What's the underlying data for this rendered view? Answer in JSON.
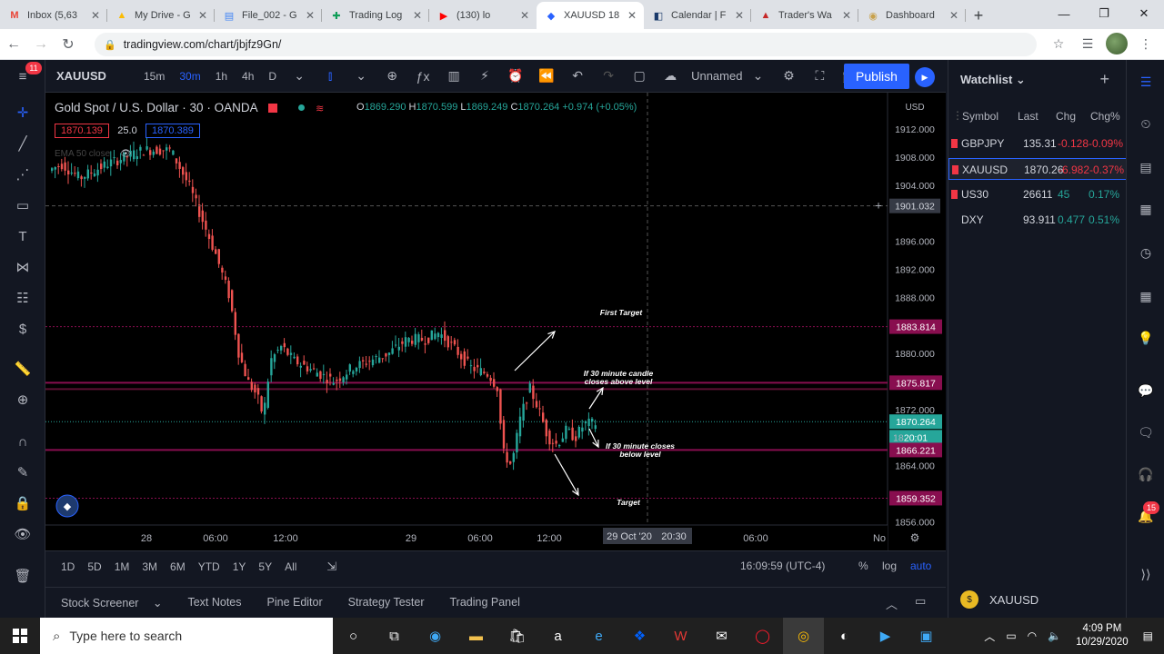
{
  "browser": {
    "tabs": [
      {
        "title": "Inbox (5,63",
        "icon": "gmail-icon",
        "color": "#ea4335",
        "glyph": "M"
      },
      {
        "title": "My Drive - G",
        "icon": "drive-icon",
        "color": "#fbbc04",
        "glyph": "▲"
      },
      {
        "title": "File_002 - G",
        "icon": "docs-icon",
        "color": "#4285f4",
        "glyph": "▤"
      },
      {
        "title": "Trading Log",
        "icon": "sheets-icon",
        "color": "#0f9d58",
        "glyph": "✚"
      },
      {
        "title": "(130) lo",
        "icon": "youtube-icon",
        "color": "#ff0000",
        "glyph": "▶"
      },
      {
        "title": "XAUUSD 18",
        "icon": "tradingview-icon",
        "color": "#2962ff",
        "glyph": "◆"
      },
      {
        "title": "Calendar | F",
        "icon": "calendar-icon",
        "color": "#1a3a6b",
        "glyph": "◧"
      },
      {
        "title": "Trader's Wa",
        "icon": "trader-icon",
        "color": "#c62828",
        "glyph": "▲"
      },
      {
        "title": "Dashboard",
        "icon": "dashboard-icon",
        "color": "#c8a14b",
        "glyph": "◉"
      }
    ],
    "active_tab": 5,
    "url": "tradingview.com/chart/jbjfz9Gn/"
  },
  "tv": {
    "symbol": "XAUUSD",
    "intervals": [
      "15m",
      "30m",
      "1h",
      "4h",
      "D"
    ],
    "active_interval": 1,
    "layout_name": "Unnamed",
    "publish_label": "Publish",
    "left_badge": "11",
    "legend_title": "Gold Spot / U.S. Dollar · 30 · OANDA",
    "ohlc": {
      "o": "1869.290",
      "h": "1870.599",
      "l": "1869.249",
      "c": "1870.264",
      "chg": "+0.974 (+0.05%)"
    },
    "bid": "1870.139",
    "spread": "25.0",
    "ask": "1870.389",
    "ema_label": "EMA 50 close",
    "currency": "USD",
    "ranges": [
      "1D",
      "5D",
      "1M",
      "3M",
      "6M",
      "YTD",
      "1Y",
      "5Y",
      "All"
    ],
    "clock": "16:09:59 (UTC-4)",
    "opts": {
      "pct": "%",
      "log": "log",
      "auto": "auto"
    },
    "panels": [
      "Stock Screener",
      "Text Notes",
      "Pine Editor",
      "Strategy Tester",
      "Trading Panel"
    ]
  },
  "chart_data": {
    "type": "candlestick",
    "y_axis": {
      "ticks": [
        "1912.000",
        "1908.000",
        "1904.000",
        "1896.000",
        "1892.000",
        "1888.000",
        "1880.000",
        "1872.000",
        "1864.000",
        "1856.000"
      ]
    },
    "x_axis": {
      "ticks": [
        "28",
        "06:00",
        "12:00",
        "29",
        "06:00",
        "12:00",
        "06:00",
        "No"
      ]
    },
    "crosshair": {
      "price": "1901.032",
      "time": "29 Oct '20",
      "time2": "20:30"
    },
    "price_labels": [
      {
        "value": "1883.814",
        "color": "#880e4f"
      },
      {
        "value": "1875.817",
        "color": "#880e4f"
      },
      {
        "value": "1870.264",
        "color": "#26a69a"
      },
      {
        "value": "20:01",
        "color": "#26a69a"
      },
      {
        "value": "1866.221",
        "color": "#880e4f"
      },
      {
        "value": "1859.352",
        "color": "#880e4f"
      }
    ],
    "partial_tick": "18",
    "annotations": [
      "First Target",
      "If 30 minute candle closes above level",
      "If 30 minute closes below level",
      "Target"
    ],
    "bull_color": "#26a69a",
    "bear_color": "#ef5350"
  },
  "watchlist": {
    "title": "Watchlist",
    "columns": [
      "Symbol",
      "Last",
      "Chg",
      "Chg%"
    ],
    "rows": [
      {
        "symbol": "GBPJPY",
        "last": "135.31",
        "chg": "-0.128",
        "pct": "-0.09%",
        "neg": true
      },
      {
        "symbol": "XAUUSD",
        "last": "1870.26",
        "chg": "-6.982",
        "pct": "-0.37%",
        "neg": true
      },
      {
        "symbol": "US30",
        "last": "26611",
        "chg": "45",
        "pct": "0.17%",
        "neg": false
      },
      {
        "symbol": "DXY",
        "last": "93.911",
        "chg": "0.477",
        "pct": "0.51%",
        "neg": false
      }
    ],
    "footer_symbol": "XAUUSD",
    "notif_badge": "15"
  },
  "taskbar": {
    "search_placeholder": "Type here to search",
    "time": "4:09 PM",
    "date": "10/29/2020"
  }
}
